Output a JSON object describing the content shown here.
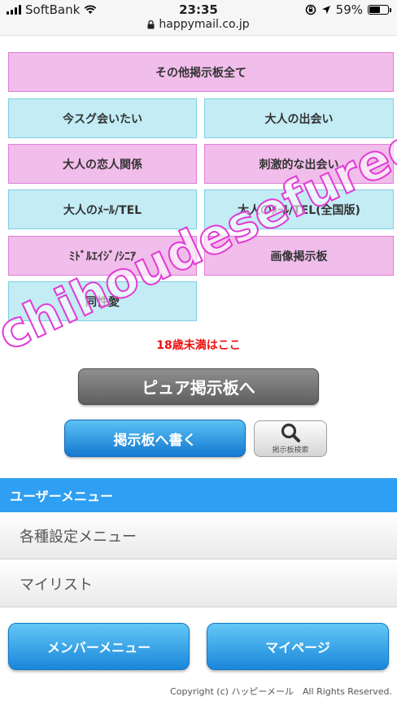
{
  "status_bar": {
    "carrier": "SoftBank",
    "time": "23:35",
    "battery": "59%",
    "battery_level": 0.59,
    "url": "happymail.co.jp"
  },
  "boards": [
    "その他掲示板全て",
    "今スグ会いたい",
    "大人の出会い",
    "大人の恋人関係",
    "刺激的な出会い",
    "大人のﾒｰﾙ/TEL",
    "大人のﾒｰﾙ/TEL(全国版)",
    "ﾐﾄﾞﾙｴｲｼﾞ/ｼﾆｱ",
    "画像掲示板",
    "同性愛"
  ],
  "under18_link": "18歳未満はここ",
  "pure_board_button": "ピュア掲示板へ",
  "write_button": "掲示板へ書く",
  "search_button": {
    "label": "掲示板検索",
    "icon": "search-icon"
  },
  "user_menu": {
    "header": "ユーザーメニュー",
    "items": [
      "各種設定メニュー",
      "マイリスト"
    ]
  },
  "bottom_buttons": [
    "メンバーメニュー",
    "マイページ"
  ],
  "copyright": "Copyright (c) ハッピーメール　All Rights Reserved.",
  "watermark": "chihoudesefureget.net",
  "colors": {
    "pink_board": "#f1bdea",
    "cyan_board": "#c3ecf5",
    "accent_blue": "#2e9ff2",
    "warning_red": "#ee1111"
  }
}
